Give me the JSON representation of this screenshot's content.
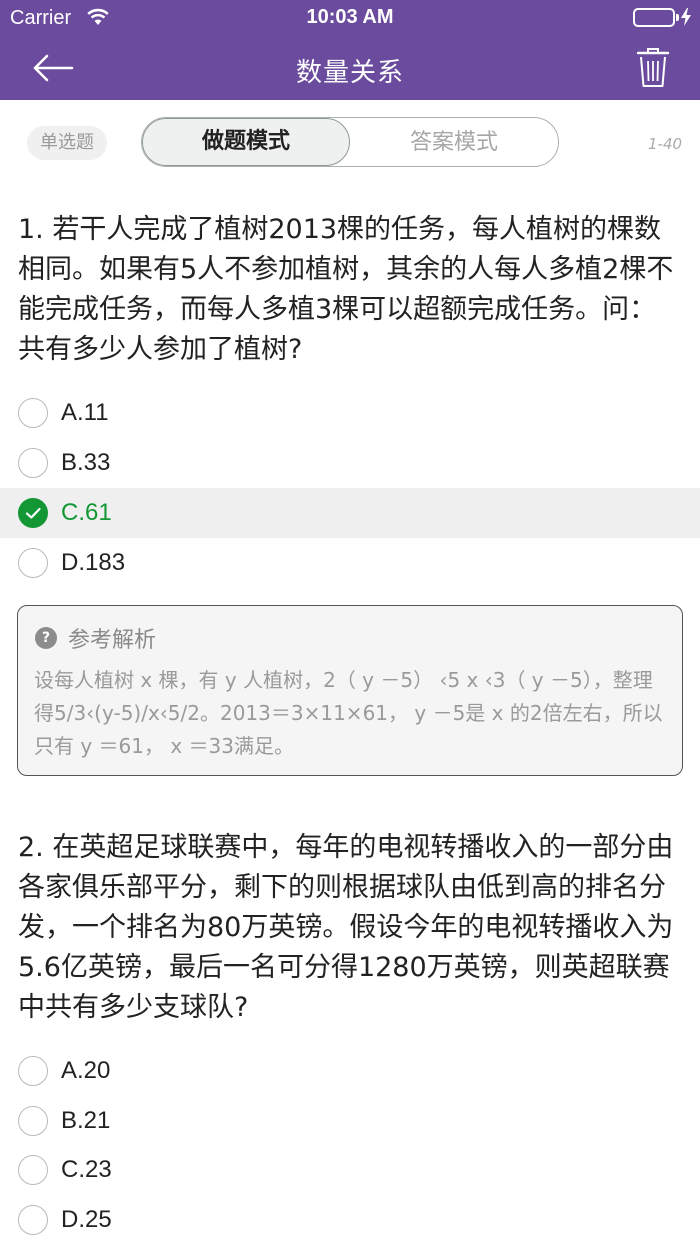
{
  "status": {
    "carrier": "Carrier",
    "time": "10:03 AM",
    "battery_level": 1.0
  },
  "nav": {
    "title": "数量关系",
    "back_icon": "arrow-left-icon",
    "trash_icon": "trash-icon"
  },
  "modebar": {
    "qtype": "单选题",
    "mode_practice": "做题模式",
    "mode_answer": "答案模式",
    "active_mode": "做题模式",
    "range": "1-40"
  },
  "questions": [
    {
      "text": "1. 若干人完成了植树2013棵的任务，每人植树的棵数相同。如果有5人不参加植树，其余的人每人多植2棵不能完成任务，而每人多植3棵可以超额完成任务。问：共有多少人参加了植树?",
      "options": [
        "A.11",
        "B.33",
        "C.61",
        "D.183"
      ],
      "selected": "C.61",
      "analysis": {
        "title": "参考解析",
        "text": "设每人植树 x 棵，有 y 人植树，2（ y －5） ‹5 x ‹3（ y －5），整理得5/3‹(y-5)/x‹5/2。2013＝3×11×61， y －5是 x 的2倍左右，所以只有 y ＝61， x ＝33满足。"
      }
    },
    {
      "text": "2. 在英超足球联赛中，每年的电视转播收入的一部分由各家俱乐部平分，剩下的则根据球队由低到高的排名分发，一个排名为80万英镑。假设今年的电视转播收入为5.6亿英镑，最后一名可分得1280万英镑，则英超联赛中共有多少支球队?",
      "options": [
        "A.20",
        "B.21",
        "C.23",
        "D.25"
      ]
    }
  ],
  "colors": {
    "header": "#6a4b9d",
    "correct": "#139734",
    "battery": "#4cd964"
  }
}
